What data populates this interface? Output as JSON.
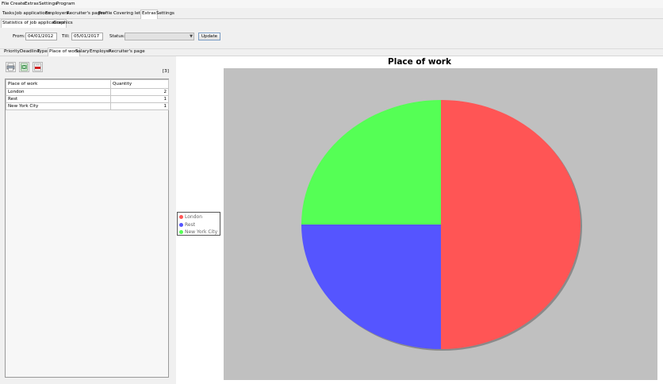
{
  "menu": [
    "File",
    "Create",
    "Extras",
    "Settings",
    "Program"
  ],
  "main_tabs": [
    "Tasks",
    "Job applications",
    "Employers",
    "Recruiter's pages",
    "Profile",
    "Covering letter",
    "Extras",
    "Settings"
  ],
  "main_tab_active": "Extras",
  "sub_tabs": [
    "Statistics of job applications",
    "Graphics"
  ],
  "filter": {
    "from_label": "From:",
    "from_value": "04/01/2012",
    "till_label": "Till:",
    "till_value": "05/01/2017",
    "status_label": "Status:",
    "status_value": "",
    "update_label": "Update"
  },
  "stats_tabs": [
    "Priority",
    "Deadline",
    "Type",
    "Place of work",
    "Salary",
    "Employer",
    "Recruiter's page"
  ],
  "stats_tab_active": "Place of work",
  "toolbar": {
    "icons": [
      "print-icon",
      "excel-export-icon",
      "pdf-export-icon"
    ]
  },
  "result_count": "[3]",
  "table": {
    "columns": [
      "Place of work",
      "Quantity"
    ],
    "rows": [
      [
        "London",
        "2"
      ],
      [
        "Rest",
        "1"
      ],
      [
        "New York City",
        "1"
      ]
    ]
  },
  "chart_data": {
    "type": "pie",
    "title": "Place of work",
    "categories": [
      "London",
      "Rest",
      "New York City"
    ],
    "values": [
      2,
      1,
      1
    ],
    "colors": [
      "#ff5555",
      "#5555ff",
      "#55ff55"
    ],
    "legend_position": "left"
  }
}
